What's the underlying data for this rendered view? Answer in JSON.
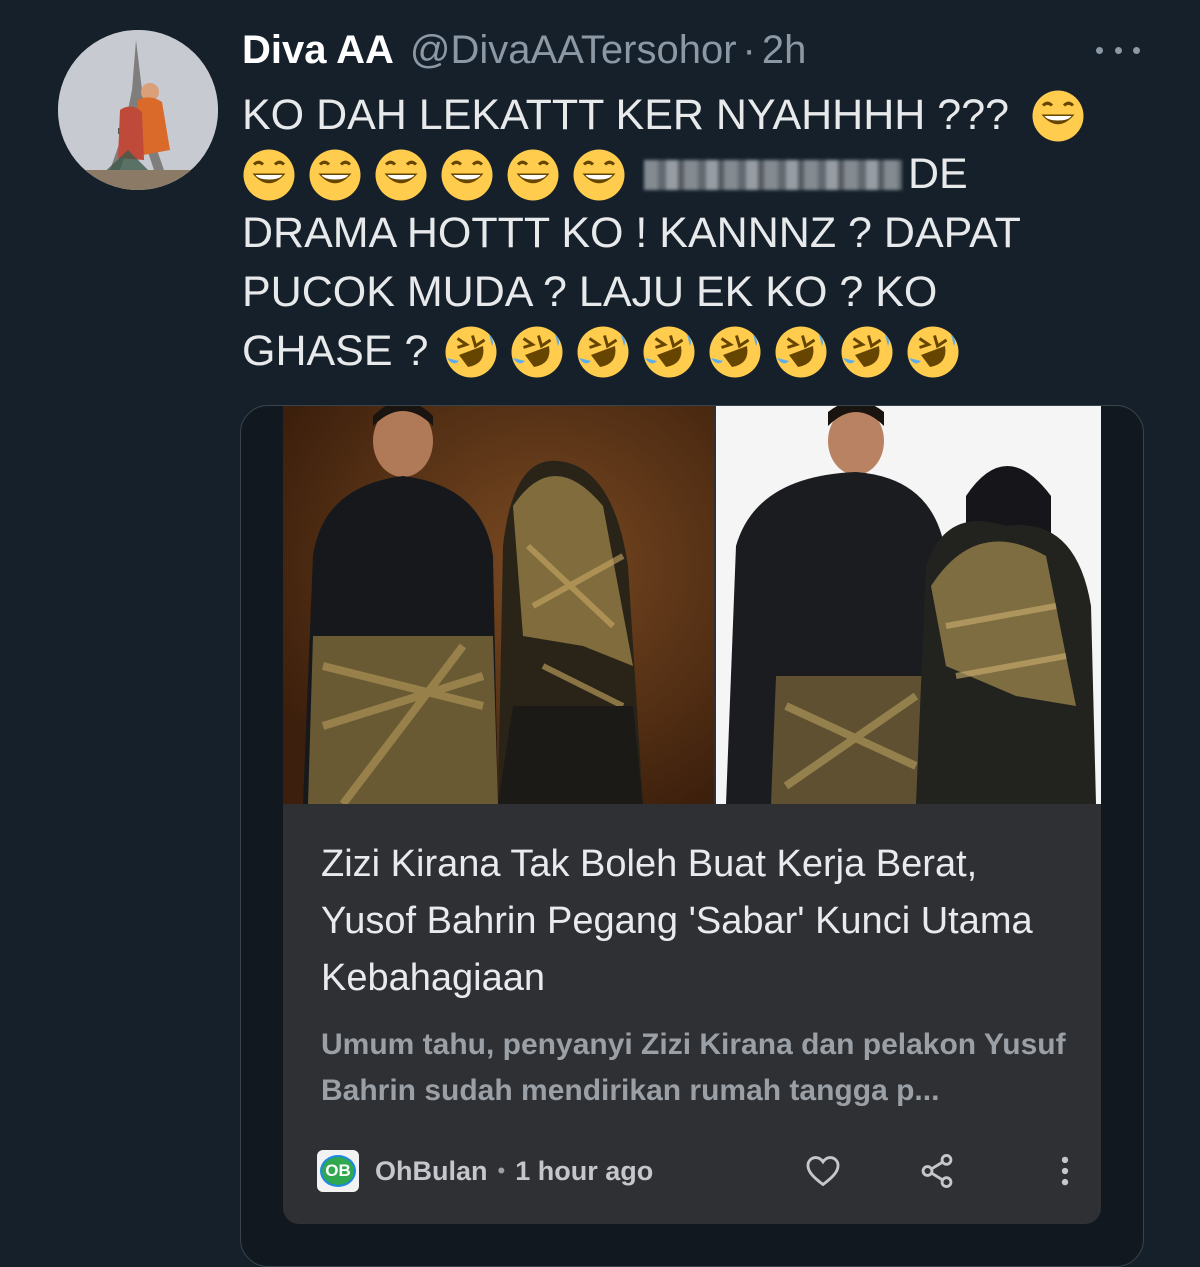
{
  "tweet": {
    "author_name": "Diva AA",
    "author_handle": "@DivaAATersohor",
    "separator": "·",
    "timestamp": "2h",
    "more_icon": "more-horizontal-icon",
    "lines": [
      "KO DAH LEKATTT KER NYAHHHH ???",
      "DE",
      "DRAMA HOTTT KO ! KANNNZ ? DAPAT",
      "PUCOK MUDA ? LAJU EK KO ? KO",
      "GHASE ?"
    ],
    "emoji_grin_name": "grinning-face-with-smiling-eyes",
    "emoji_rofl_name": "rolling-on-the-floor-laughing",
    "redacted_text": "blurred-name"
  },
  "card": {
    "headline": "Zizi Kirana Tak Boleh Buat Kerja Berat, Yusof Bahrin Pegang 'Sabar' Kunci Utama Kebahagiaan",
    "snippet": "Umum tahu, penyanyi Zizi Kirana dan pelakon Yusuf Bahrin sudah mendirikan rumah tangga p...",
    "source_logo_text": "OB",
    "source_name": "OhBulan",
    "source_separator": "•",
    "time_ago": "1 hour ago",
    "icons": [
      "heart-icon",
      "share-icon",
      "more-vertical-icon"
    ]
  },
  "colors": {
    "background": "#15202b",
    "text": "#e7e9ea",
    "secondary": "#8b98a5",
    "card_inner": "#2f3033"
  }
}
